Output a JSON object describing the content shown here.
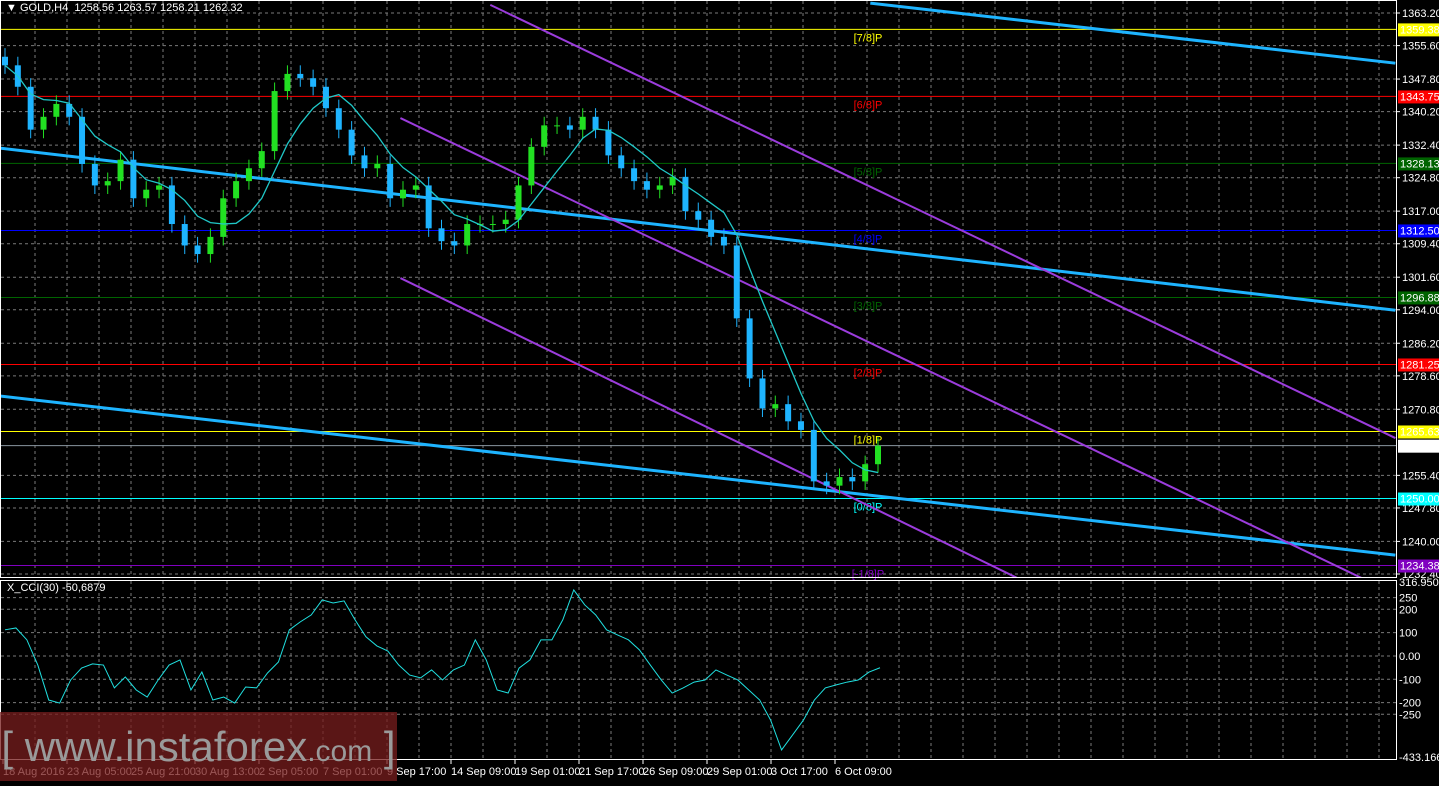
{
  "header": {
    "symbol": "GOLD,H4",
    "open": "1258.56",
    "high": "1263.57",
    "low": "1258.21",
    "close": "1262.32"
  },
  "indicator": {
    "title": "X_CCI(30) -50,6879"
  },
  "watermark": {
    "open_bracket": "[",
    "site": "www.instaforex",
    "tld": ".com",
    "close_bracket": "]"
  },
  "chart_data": [
    {
      "type": "candlestick",
      "symbol": "GOLD",
      "timeframe": "H4",
      "x_tick_labels": [
        "18 Aug 2016",
        "23 Aug 05:00",
        "25 Aug 21:00",
        "30 Aug 13:00",
        "2 Sep 05:00",
        "7 Sep 01:00",
        "9 Sep 17:00",
        "14 Sep 09:00",
        "19 Sep 01:00",
        "21 Sep 17:00",
        "26 Sep 09:00",
        "29 Sep 01:00",
        "3 Oct 17:00",
        "6 Oct 09:00"
      ],
      "y_tick_labels": [
        "1363.20",
        "1355.60",
        "1347.80",
        "1340.20",
        "1332.40",
        "1324.80",
        "1317.00",
        "1309.40",
        "1301.60",
        "1294.00",
        "1286.20",
        "1278.60",
        "1270.80",
        "1255.40",
        "1247.80",
        "1240.00",
        "1232.40"
      ],
      "ylim": [
        1232.4,
        1363.2
      ],
      "grid": true,
      "first_open": 1353,
      "close": [
        1351,
        1346,
        1336,
        1339,
        1342,
        1339,
        1328,
        1323,
        1324,
        1329,
        1320,
        1322,
        1323,
        1314,
        1309,
        1307,
        1311,
        1320,
        1324,
        1327,
        1331,
        1345,
        1349,
        1348,
        1346,
        1341,
        1336,
        1330,
        1327,
        1328,
        1320,
        1322,
        1323,
        1313,
        1310,
        1309,
        1314,
        1314,
        1314,
        1315,
        1323,
        1332,
        1337,
        1337,
        1336,
        1339,
        1336,
        1330,
        1327,
        1324,
        1322,
        1323,
        1325,
        1317,
        1315,
        1311,
        1309,
        1292,
        1278,
        1271,
        1272,
        1268,
        1266,
        1254,
        1253,
        1255,
        1254,
        1258,
        1262.32
      ],
      "current_price": {
        "value": 1262.32,
        "label": "1262.32",
        "color": "#ffffff"
      },
      "colors": {
        "bull": "#22e022",
        "bear": "#1eb4ff",
        "ma": "#20c8c8",
        "trend": "#1eb4ff",
        "channel": "#9b3cdc",
        "grid": "#7a7a7a"
      },
      "murrey_levels": [
        {
          "label": "[7/8]P",
          "value": 1359.38,
          "price_label": "1359.38",
          "color": "#ffff00",
          "text_color": "#000000"
        },
        {
          "label": "[6/8]P",
          "value": 1343.75,
          "price_label": "1343.75",
          "color": "#ff0000",
          "text_color": "#000000"
        },
        {
          "label": "[5/8]P",
          "value": 1328.13,
          "price_label": "1328.13",
          "color": "#006400",
          "text_color": "#000000"
        },
        {
          "label": "[4/8]P",
          "value": 1312.5,
          "price_label": "1312.50",
          "color": "#0000ff",
          "text_color": "#000000"
        },
        {
          "label": "[3/8]P",
          "value": 1296.88,
          "price_label": "1296.88",
          "color": "#006400",
          "text_color": "#000000"
        },
        {
          "label": "[2/8]P",
          "value": 1281.25,
          "price_label": "1281.25",
          "color": "#ff0000",
          "text_color": "#000000"
        },
        {
          "label": "[1/8]P",
          "value": 1265.63,
          "price_label": "1265.63",
          "color": "#ffff00",
          "text_color": "#000000"
        },
        {
          "label": "[0/8]P",
          "value": 1250.0,
          "price_label": "1250.00",
          "color": "#00ffff",
          "text_color": "#000000"
        },
        {
          "label": "[-1/8]P",
          "value": 1234.38,
          "price_label": "1234.38",
          "color": "#8000c0",
          "text_color": "#000000"
        }
      ],
      "trend_lines": [
        {
          "kind": "trend",
          "from": [
            -0.4,
            1331.7
          ],
          "to": [
            108.3,
            1293.9
          ]
        },
        {
          "kind": "trend",
          "from": [
            -0.4,
            1273.9
          ],
          "to": [
            108.3,
            1236.8
          ]
        },
        {
          "kind": "trend",
          "from": [
            67.4,
            1365.5
          ],
          "to": [
            108.3,
            1351.5
          ]
        },
        {
          "kind": "channel",
          "from": [
            37.8,
            1365.1
          ],
          "to": [
            108.3,
            1264.1
          ]
        },
        {
          "kind": "channel",
          "from": [
            30.8,
            1338.7
          ],
          "to": [
            108.3,
            1227.7
          ]
        },
        {
          "kind": "channel",
          "from": [
            30.8,
            1301.4
          ],
          "to": [
            108.3,
            1188.6
          ]
        }
      ]
    },
    {
      "type": "line",
      "title": "X_CCI(30) -50,6879",
      "ylim": [
        -433.1663,
        316.9504
      ],
      "y_tick_labels": [
        "316.9504",
        "250",
        "200",
        "100",
        "0.00",
        "-100",
        "-200",
        "-250",
        "-433.1663"
      ],
      "color": "#20e0e0",
      "values": [
        112,
        120,
        69,
        -39,
        -189,
        -202,
        -103,
        -52,
        -34,
        -39,
        -137,
        -90,
        -146,
        -176,
        -103,
        -39,
        -17,
        -146,
        -69,
        -189,
        -176,
        -202,
        -133,
        -137,
        -73,
        -26,
        112,
        146,
        176,
        240,
        227,
        236,
        155,
        82,
        43,
        21,
        -39,
        -82,
        -94,
        -60,
        -103,
        -60,
        -39,
        69,
        -17,
        -146,
        -159,
        -52,
        -17,
        69,
        69,
        155,
        283,
        219,
        176,
        112,
        90,
        69,
        26,
        -39,
        -103,
        -159,
        -137,
        -112,
        -103,
        -60,
        -82,
        -103,
        -146,
        -189,
        -275,
        -403,
        -339,
        -275,
        -189,
        -137,
        -124,
        -112,
        -103,
        -69,
        -50.69
      ]
    }
  ]
}
